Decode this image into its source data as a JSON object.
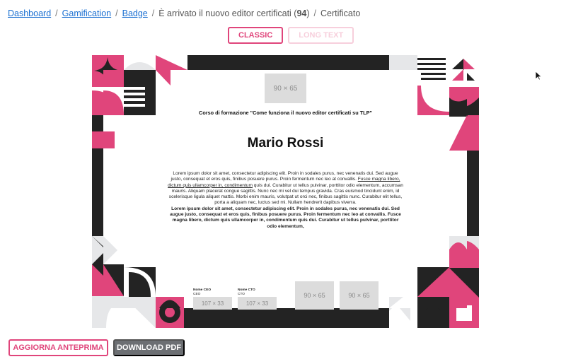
{
  "breadcrumb": {
    "items": [
      "Dashboard",
      "Gamification",
      "Badge"
    ],
    "current_prefix": "È arrivato il nuovo editor certificati (",
    "current_count": "94",
    "current_suffix": ")",
    "last": "Certificato",
    "separator": "/"
  },
  "mode_tabs": {
    "classic": "CLASSIC",
    "long_text": "LONG TEXT"
  },
  "certificate": {
    "logo_placeholder": "90 × 65",
    "course_title": "Corso di formazione \"Come funziona il nuovo editor certificati su TLP\"",
    "recipient_name": "Mario Rossi",
    "body_part1": "Lorem ipsum dolor sit amet, consectetur adipiscing elit. Proin in sodales purus, nec venenatis dui. Sed augue justo, consequat et eros quis, finibus posuere purus. Proin fermentum nec leo at convallis. ",
    "body_underlined": "Fusce magna libero, dictum quis ullamcorper in, condimentum",
    "body_part2": " quis dui. Curabitur ut tellus pulvinar, porttitor odio elementum, accumsan mauris. Aliquam placerat congue sagittis. Nunc nec mi vel dui tempus gravida. Cras euismod tincidunt enim, id scelerisque ligula aliquet mattis. Morbi enim mauris, volutpat ut orci nec, finibus sagittis nunc. Curabitur elit tellus, porta a aliquam nec, luctus sed mi. Nullam hendrerit dapibus viverra.",
    "body_bold": "Lorem ipsum dolor sit amet, consectetur adipiscing elit. Proin in sodales purus, nec venenatis dui. Sed augue justo, consequat et eros quis, finibus posuere purus. Proin fermentum nec leo at convallis. Fusce magna libero, dictum quis ullamcorper in, condimentum quis dui. Curabitur ut tellus pulvinar, porttitor odio elementum,",
    "signatures": [
      {
        "role": "Nome CEO",
        "title": "CEO",
        "placeholder": "107 × 33"
      },
      {
        "role": "Nome CTO",
        "title": "CTO",
        "placeholder": "107 × 33"
      }
    ],
    "stamps": [
      "90 × 65",
      "90 × 65"
    ]
  },
  "actions": {
    "refresh_preview": "AGGIORNA ANTEPRIMA",
    "download_pdf": "DOWNLOAD PDF"
  },
  "colors": {
    "accent": "#e0457b",
    "dark": "#232323",
    "light_gray": "#e6e7e9",
    "link": "#1a6fd1"
  }
}
